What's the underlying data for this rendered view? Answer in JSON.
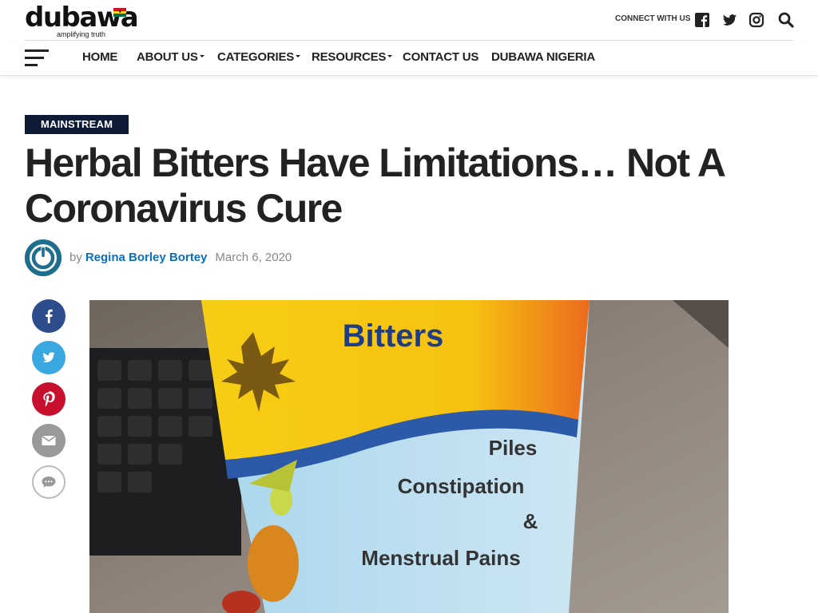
{
  "site": {
    "logo_text": "dubawa",
    "tagline": "amplifying truth",
    "connect_label": "CONNECT WITH US",
    "icons": [
      "facebook-icon",
      "twitter-icon",
      "instagram-icon",
      "search-icon"
    ]
  },
  "nav": {
    "items": [
      {
        "label": "HOME",
        "dropdown": false
      },
      {
        "label": "ABOUT US",
        "dropdown": true
      },
      {
        "label": "CATEGORIES",
        "dropdown": true
      },
      {
        "label": "RESOURCES",
        "dropdown": true
      },
      {
        "label": "CONTACT US",
        "dropdown": false
      },
      {
        "label": "DUBAWA NIGERIA",
        "dropdown": false
      }
    ]
  },
  "article": {
    "category": "MAINSTREAM",
    "title": "Herbal Bitters Have Limitations… Not A Coronavirus Cure",
    "by": "by",
    "author": "Regina Borley Bortey",
    "date": "March 6, 2020"
  },
  "share": {
    "buttons": [
      "facebook-share",
      "twitter-share",
      "pinterest-share",
      "email-share",
      "comment"
    ]
  },
  "image": {
    "product_heading": "Bitters",
    "lines": [
      "Piles",
      "Constipation",
      "&",
      "Menstrual Pains"
    ]
  },
  "colors": {
    "navy": "#0d1b36",
    "link": "#0b6fc1",
    "facebook": "#2d4c8c",
    "twitter": "#3aa8e0",
    "pinterest": "#c8102e",
    "email": "#999999"
  }
}
